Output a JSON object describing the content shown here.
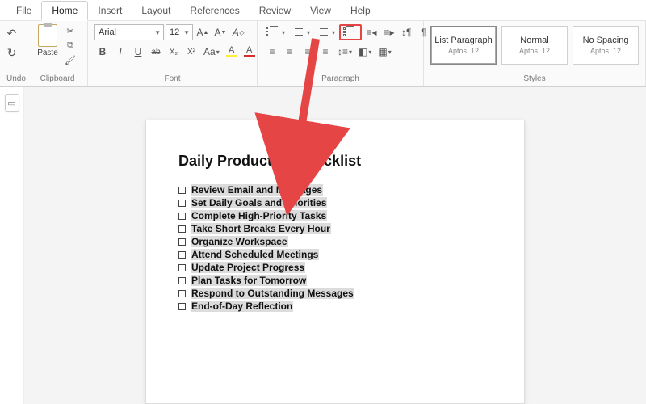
{
  "menu": {
    "items": [
      "File",
      "Home",
      "Insert",
      "Layout",
      "References",
      "Review",
      "View",
      "Help"
    ],
    "active": "Home"
  },
  "ribbon": {
    "undo_group_label": "Undo",
    "clipboard": {
      "paste_label": "Paste",
      "group_label": "Clipboard"
    },
    "font": {
      "group_label": "Font",
      "font_name": "Arial",
      "font_size": "12",
      "bold": "B",
      "italic": "I",
      "underline": "U",
      "strike": "ab",
      "sub": "X₂",
      "sup": "X²",
      "case": "Aa",
      "clear": "⌫",
      "textfx": "A",
      "highlight": "A",
      "fontcolor": "A",
      "grow": "A^",
      "shrink": "A˅"
    },
    "paragraph": {
      "group_label": "Paragraph"
    },
    "styles": {
      "group_label": "Styles",
      "cards": [
        {
          "title": "List Paragraph",
          "sub": "Aptos, 12",
          "selected": true
        },
        {
          "title": "Normal",
          "sub": "Aptos, 12",
          "selected": false
        },
        {
          "title": "No Spacing",
          "sub": "Aptos, 12",
          "selected": false
        }
      ]
    }
  },
  "document": {
    "title": "Daily Productive Checklist",
    "items": [
      "Review Email and Messages",
      "Set Daily Goals and Priorities",
      " Complete High-Priority Tasks",
      "Take Short Breaks Every Hour",
      "Organize Workspace",
      " Attend Scheduled Meetings",
      "Update Project Progress",
      " Plan Tasks for Tomorrow",
      "Respond to Outstanding Messages",
      "End-of-Day Reflection"
    ]
  }
}
